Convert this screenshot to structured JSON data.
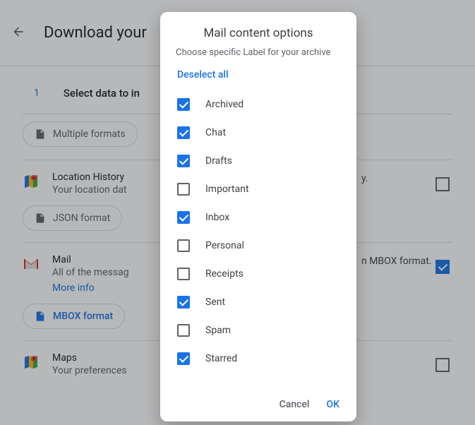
{
  "header": {
    "title": "Download your"
  },
  "step": {
    "number": "1",
    "title": "Select data to in"
  },
  "chips": {
    "multiple_formats": "Multiple formats",
    "json_format": "JSON format",
    "mbox_format": "MBOX format"
  },
  "products": {
    "location_history": {
      "title": "Location History",
      "desc": "Your location dat",
      "tail": "y."
    },
    "mail": {
      "title": "Mail",
      "desc": "All of the messag",
      "tail": "n MBOX format.",
      "more_info": "More info"
    },
    "maps": {
      "title": "Maps",
      "desc": "Your preferences"
    }
  },
  "dialog": {
    "title": "Mail content options",
    "subtitle": "Choose specific Label for your archive",
    "deselect": "Deselect all",
    "options": [
      {
        "label": "Archived",
        "checked": true
      },
      {
        "label": "Chat",
        "checked": true
      },
      {
        "label": "Drafts",
        "checked": true
      },
      {
        "label": "Important",
        "checked": false
      },
      {
        "label": "Inbox",
        "checked": true
      },
      {
        "label": "Personal",
        "checked": false
      },
      {
        "label": "Receipts",
        "checked": false
      },
      {
        "label": "Sent",
        "checked": true
      },
      {
        "label": "Spam",
        "checked": false
      },
      {
        "label": "Starred",
        "checked": true
      }
    ],
    "cancel": "Cancel",
    "ok": "OK"
  }
}
